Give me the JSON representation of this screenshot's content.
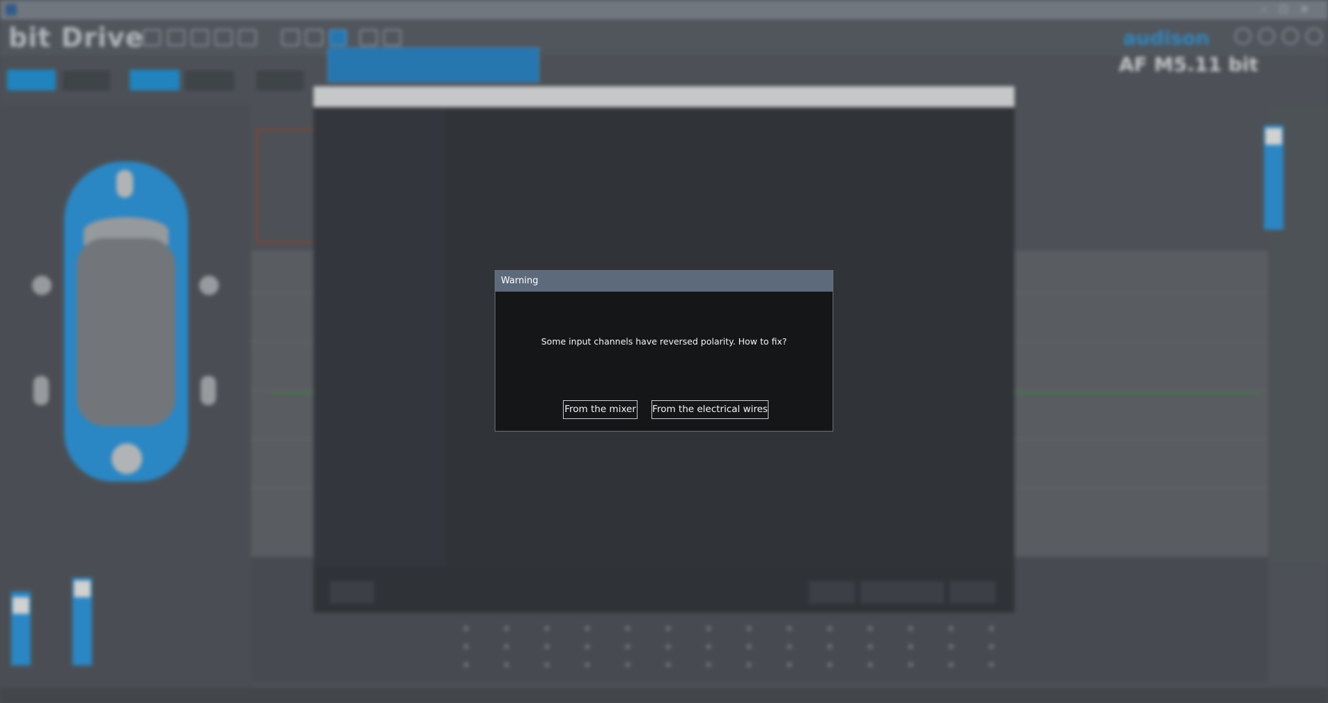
{
  "dialog": {
    "title": "Warning",
    "message": "Some input channels have reversed polarity. How to fix?",
    "buttons": {
      "from_mixer": "From the mixer",
      "from_wires": "From the electrical wires"
    }
  },
  "background_app": {
    "logo": "bit Drive",
    "brand": "audison",
    "model": "AF M5.11 bit"
  },
  "colors": {
    "accent_blue": "#35a4ef",
    "dialog_title_bar": "#5d6a7c",
    "dialog_body": "#141618",
    "orange": "#d9822b",
    "error_red": "#e0483a"
  }
}
